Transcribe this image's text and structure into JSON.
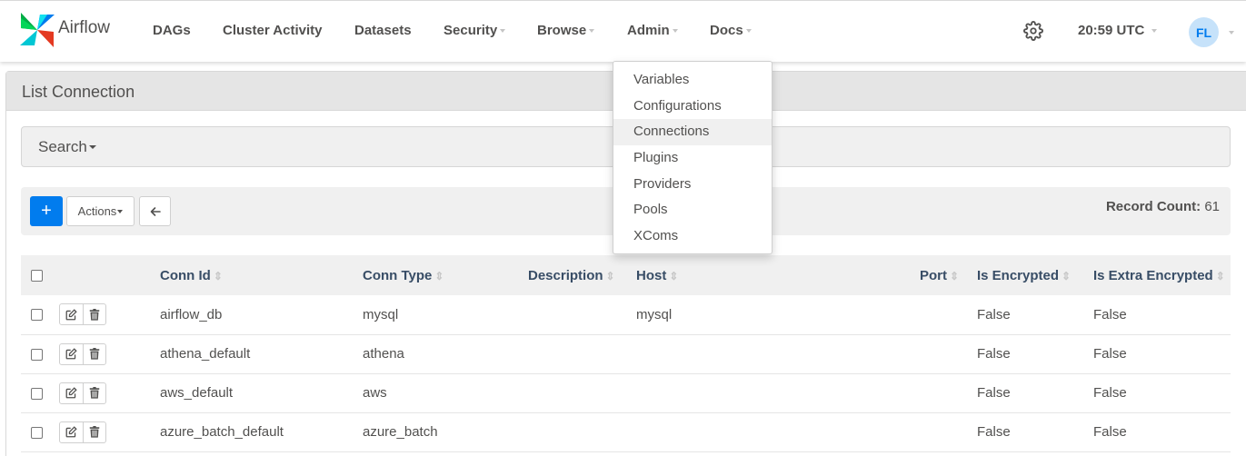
{
  "brand": {
    "name": "Airflow"
  },
  "nav": {
    "items": [
      {
        "label": "DAGs"
      },
      {
        "label": "Cluster Activity"
      },
      {
        "label": "Datasets"
      },
      {
        "label": "Security"
      },
      {
        "label": "Browse"
      },
      {
        "label": "Admin"
      },
      {
        "label": "Docs"
      }
    ],
    "time": "20:59 UTC",
    "user_initials": "FL"
  },
  "panel": {
    "title": "List Connection"
  },
  "search": {
    "label": "Search"
  },
  "actions": {
    "add_label": "+",
    "actions_label": "Actions",
    "record_count_label": "Record Count:",
    "record_count_value": "61"
  },
  "table": {
    "headers": [
      "Conn Id",
      "Conn Type",
      "Description",
      "Host",
      "Port",
      "Is Encrypted",
      "Is Extra Encrypted"
    ],
    "rows": [
      {
        "conn_id": "airflow_db",
        "conn_type": "mysql",
        "description": "",
        "host": "mysql",
        "port": "",
        "is_encrypted": "False",
        "is_extra_encrypted": "False"
      },
      {
        "conn_id": "athena_default",
        "conn_type": "athena",
        "description": "",
        "host": "",
        "port": "",
        "is_encrypted": "False",
        "is_extra_encrypted": "False"
      },
      {
        "conn_id": "aws_default",
        "conn_type": "aws",
        "description": "",
        "host": "",
        "port": "",
        "is_encrypted": "False",
        "is_extra_encrypted": "False"
      },
      {
        "conn_id": "azure_batch_default",
        "conn_type": "azure_batch",
        "description": "",
        "host": "",
        "port": "",
        "is_encrypted": "False",
        "is_extra_encrypted": "False"
      }
    ]
  },
  "admin_menu": {
    "items": [
      {
        "label": "Variables"
      },
      {
        "label": "Configurations"
      },
      {
        "label": "Connections"
      },
      {
        "label": "Plugins"
      },
      {
        "label": "Providers"
      },
      {
        "label": "Pools"
      },
      {
        "label": "XComs"
      }
    ],
    "active": "Connections"
  },
  "colors": {
    "accent": "#017cee",
    "header_text": "#384d66",
    "avatar_bg": "#c6e2fa"
  },
  "icons": {
    "brand": "pinwheel-logo-icon",
    "settings": "gear-icon",
    "back": "arrow-left-icon",
    "edit": "edit-icon",
    "delete": "trash-icon",
    "sort": "sort-icon"
  }
}
